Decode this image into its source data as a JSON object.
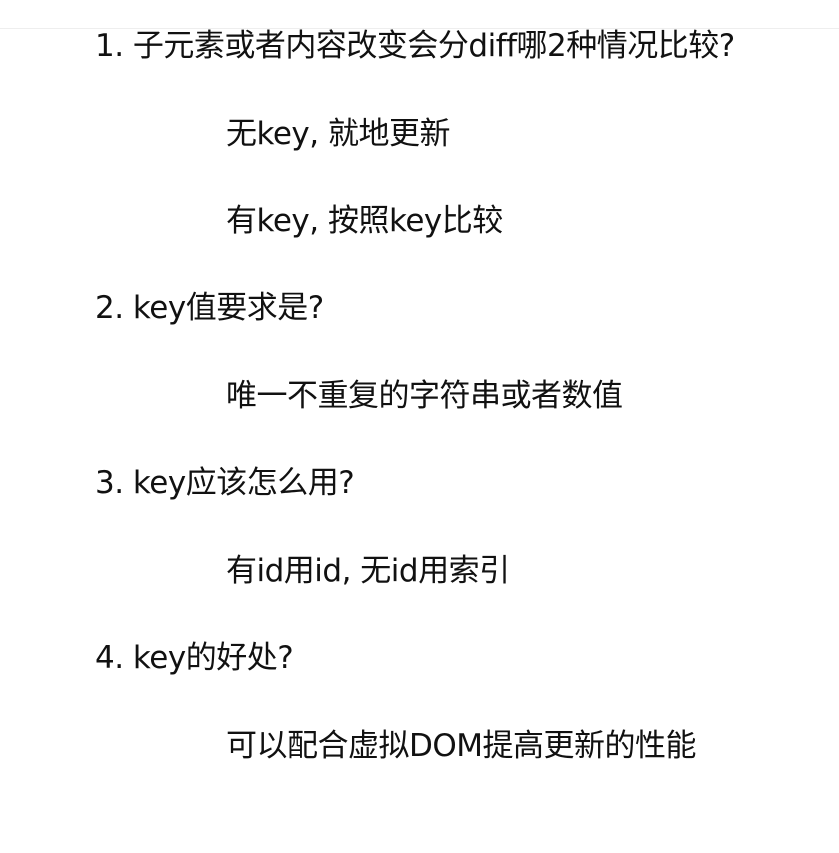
{
  "document": {
    "items": [
      {
        "question": "1. 子元素或者内容改变会分diff哪2种情况比较?",
        "answers": [
          "无key, 就地更新",
          "有key, 按照key比较"
        ]
      },
      {
        "question": "2. key值要求是?",
        "answers": [
          "唯一不重复的字符串或者数值"
        ]
      },
      {
        "question": "3. key应该怎么用?",
        "answers": [
          "有id用id, 无id用索引"
        ]
      },
      {
        "question": "4. key的好处?",
        "answers": [
          "可以配合虚拟DOM提高更新的性能"
        ]
      }
    ]
  }
}
